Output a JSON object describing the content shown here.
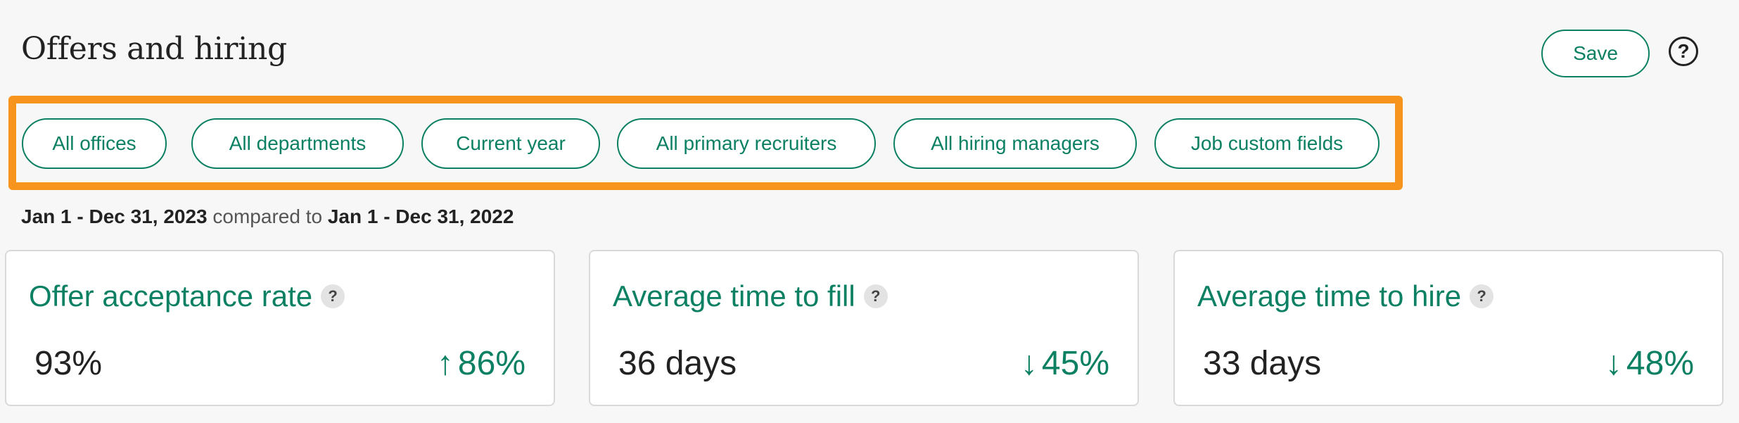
{
  "header": {
    "title": "Offers and hiring",
    "save_label": "Save",
    "help_icon": "?"
  },
  "filters": [
    {
      "label": "All offices"
    },
    {
      "label": "All departments"
    },
    {
      "label": "Current year"
    },
    {
      "label": "All primary recruiters"
    },
    {
      "label": "All hiring managers"
    },
    {
      "label": "Job custom fields"
    }
  ],
  "date_range": {
    "current": "Jan 1 - Dec 31, 2023",
    "compared_text": "compared to",
    "previous": "Jan 1 - Dec 31, 2022"
  },
  "cards": [
    {
      "title": "Offer acceptance rate",
      "help": "?",
      "value": "93%",
      "arrow": "↑",
      "change": "86%"
    },
    {
      "title": "Average time to fill",
      "help": "?",
      "value": "36 days",
      "arrow": "↓",
      "change": "45%"
    },
    {
      "title": "Average time to hire",
      "help": "?",
      "value": "33 days",
      "arrow": "↓",
      "change": "48%"
    }
  ],
  "colors": {
    "accent": "#0b8062",
    "highlight": "#f7941e",
    "background": "#f7f7f7"
  }
}
